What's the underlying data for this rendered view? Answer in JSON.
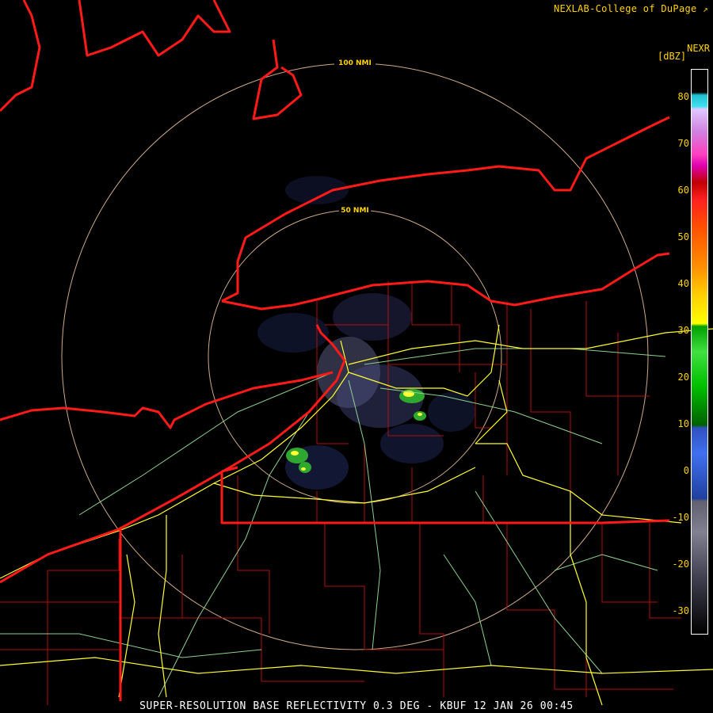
{
  "credit": "NEXLAB-College of DuPage",
  "legend": {
    "title": "NEXR",
    "unit": "[dBZ]",
    "ticks": [
      "80",
      "70",
      "60",
      "50",
      "40",
      "30",
      "20",
      "10",
      "0",
      "-10",
      "-20",
      "-30"
    ]
  },
  "rings": [
    {
      "label": "100 NMI"
    },
    {
      "label": "50 NMI"
    }
  ],
  "footer": "SUPER-RESOLUTION BASE REFLECTIVITY 0.3 DEG - KBUF 12 JAN 26 00:45",
  "colors": {
    "state_border": "#ff1a1a",
    "county_border": "#b01010",
    "interstate": "#ffff33",
    "highway": "#8fd18f",
    "range_ring": "#f0c8a0",
    "text": "#ffd400"
  }
}
